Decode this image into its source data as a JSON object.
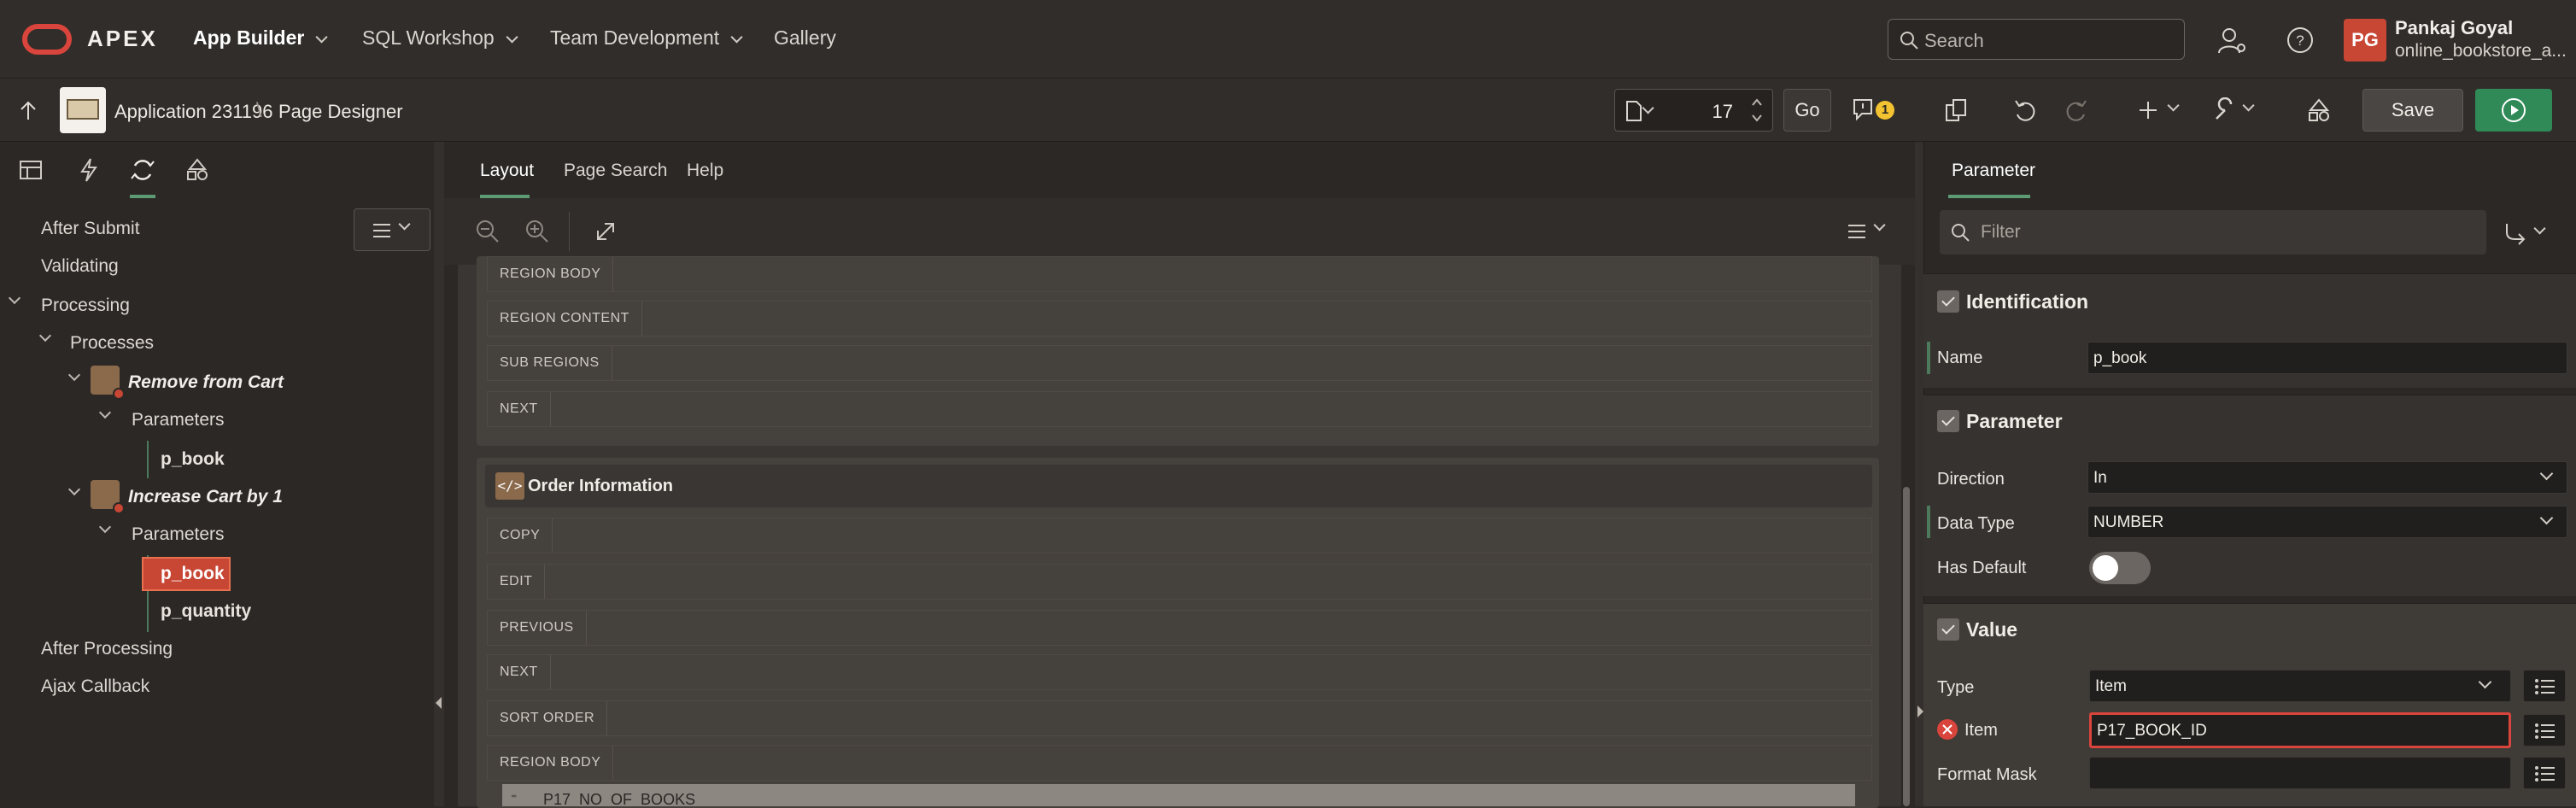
{
  "topnav": {
    "brand": "APEX",
    "items": [
      "App Builder",
      "SQL Workshop",
      "Team Development",
      "Gallery"
    ],
    "search_placeholder": "Search",
    "user_initials": "PG",
    "user_name": "Pankaj Goyal",
    "user_schema": "online_bookstore_a..."
  },
  "toolbar": {
    "app_title": "Application 231196",
    "separator": "\\",
    "page_title": "Page Designer",
    "page_number": "17",
    "go_label": "Go",
    "issues_count": "1",
    "save_label": "Save"
  },
  "left": {
    "tree": {
      "after_submit": "After Submit",
      "validating": "Validating",
      "processing": "Processing",
      "processes": "Processes",
      "process1": "Remove from Cart",
      "parameters1": "Parameters",
      "p1_param": "p_book",
      "process2": "Increase Cart by 1",
      "parameters2": "Parameters",
      "p2_param_selected": "p_book",
      "p2_param2": "p_quantity",
      "after_processing": "After Processing",
      "ajax_callback": "Ajax Callback"
    }
  },
  "middle": {
    "tabs": [
      "Layout",
      "Page Search",
      "Help"
    ],
    "region1_slots": [
      "REGION BODY",
      "REGION CONTENT",
      "SUB REGIONS",
      "NEXT"
    ],
    "region2_title": "Order Information",
    "region2_slots": [
      "COPY",
      "EDIT",
      "PREVIOUS",
      "NEXT",
      "SORT ORDER",
      "REGION BODY"
    ],
    "item_name": "P17_NO_OF_BOOKS"
  },
  "right": {
    "tab": "Parameter",
    "filter_placeholder": "Filter",
    "identification": {
      "title": "Identification",
      "name_label": "Name",
      "name_value": "p_book"
    },
    "parameter": {
      "title": "Parameter",
      "direction_label": "Direction",
      "direction_value": "In",
      "datatype_label": "Data Type",
      "datatype_value": "NUMBER",
      "hasdefault_label": "Has Default",
      "has_default": false
    },
    "value": {
      "title": "Value",
      "type_label": "Type",
      "type_value": "Item",
      "item_label": "Item",
      "item_value": "P17_BOOK_ID",
      "formatmask_label": "Format Mask",
      "formatmask_value": ""
    }
  },
  "colors": {
    "brand_red": "#c74634",
    "accent_green": "#5c9b73",
    "run_green": "#2f8a57",
    "badge_yellow": "#f2c230"
  }
}
